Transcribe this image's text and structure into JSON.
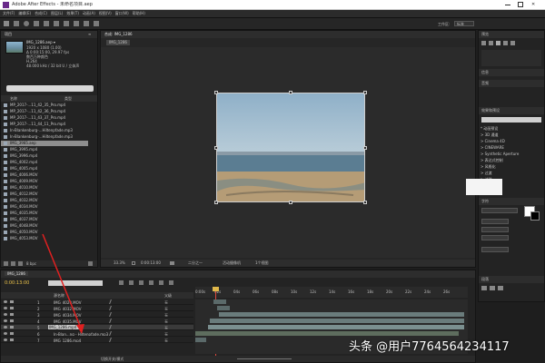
{
  "titlebar": {
    "title": "Adobe After Effects - 未命名项目.aep"
  },
  "menu": {
    "items": [
      "文件(F)",
      "编辑(E)",
      "合成(C)",
      "图层(L)",
      "效果(T)",
      "动画(A)",
      "视图(V)",
      "窗口(W)",
      "帮助(H)"
    ]
  },
  "toolbar": {
    "workspace_label": "工作区:",
    "workspace_value": "标准"
  },
  "project": {
    "tab": "项目",
    "selected_name": "IMG_1286.aep ▾",
    "info_lines": [
      "1920 x 1080 (1.00)",
      "Δ 0:00:15:00, 29.97 fps",
      "数百万种颜色",
      "H.264",
      "48.000 kHz / 32 bit U / 立体声"
    ],
    "search_placeholder": "",
    "col_name": "名称",
    "col_type": "类型",
    "files": [
      "MP_2017-...11_42_35_Pro.mp4",
      "MP_2017-...11_42_36_Pro.mp4",
      "MP_2017-...11_43_37_Pro.mp4",
      "MP_2017-...11_44_11_Pro.mp4",
      "In-Blankenburg-...Hiltenpfade.mp3",
      "In-Blankenburg-...Hiltenpfade.mp3",
      "IMG_3985.aep",
      "IMG_3995.mp4",
      "IMG_3996.mp4",
      "IMG_4002.mp4",
      "IMG_4005.mp4",
      "IMG_4006.MOV",
      "IMG_4009.MOV",
      "IMG_4010.MOV",
      "IMG_4012.MOV",
      "IMG_4032.MOV",
      "IMG_4034.MOV",
      "IMG_4035.MOV",
      "IMG_4037.MOV",
      "IMG_4048.MOV",
      "IMG_4050.MOV",
      "IMG_4053.MOV"
    ],
    "bottom_label": "8 bpc"
  },
  "viewer": {
    "tab": "合成: IMG_1286",
    "comp_chip": "IMG_1286",
    "zoom": "33.3%",
    "timecode": "0:00:13:00",
    "quality": "二分之一",
    "camera": "活动摄像机",
    "views": "1个视图"
  },
  "timeline": {
    "tab": "IMG_1286",
    "timecode": "0:00:13:00",
    "col_source": "源名称",
    "col_mode": "父级",
    "ruler": [
      "0:00s",
      "02s",
      "04s",
      "06s",
      "08s",
      "10s",
      "12s",
      "14s",
      "16s",
      "18s",
      "20s",
      "22s",
      "24s",
      "26s"
    ],
    "layers": [
      {
        "num": "1",
        "name": "IMG_4029.MOV",
        "parent": "无"
      },
      {
        "num": "2",
        "name": "IMG_4032.MOV",
        "parent": "无"
      },
      {
        "num": "3",
        "name": "IMG_4034.MOV",
        "parent": "无"
      },
      {
        "num": "4",
        "name": "IMG_4035.MOV",
        "parent": "无"
      },
      {
        "num": "5",
        "name": "IMG_1286.mp4",
        "parent": "无"
      },
      {
        "num": "6",
        "name": "In-Blan...ng - Hiltenpfade.mp3",
        "parent": "无"
      },
      {
        "num": "7",
        "name": "IMG_1286.mp4",
        "parent": "无"
      }
    ],
    "footer": "切换开关/模式"
  },
  "right_panel": {
    "preview_tab": "预览",
    "info_tab": "信息",
    "audio_tab": "音频",
    "effects_tab": "效果和预设",
    "effects_search_placeholder": "",
    "effects_items": [
      "* 动画预设",
      "> 3D 通道",
      "> Cinema 4D",
      "> CINEWARE",
      "> Synthetic Aperture",
      "> 表达式控制",
      "> 风格化",
      "> 过渡",
      "> 过时"
    ],
    "paragraph_tab": "段落",
    "character_tab": "字符"
  },
  "watermark": {
    "text": "头条 @用户7764564234117"
  },
  "colors": {
    "accent": "#3a7bd5",
    "bg": "#232323",
    "timeline_bar": "#5b6a6a"
  }
}
